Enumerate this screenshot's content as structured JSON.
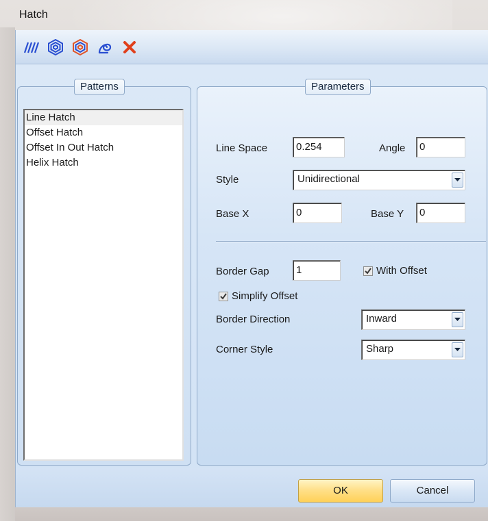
{
  "window": {
    "title": "Hatch"
  },
  "toolbar": {
    "buttons": [
      {
        "icon": "line-hatch-icon"
      },
      {
        "icon": "offset-hatch-icon"
      },
      {
        "icon": "offset-in-out-hatch-icon"
      },
      {
        "icon": "helix-hatch-icon"
      },
      {
        "icon": "close-icon"
      }
    ]
  },
  "patterns": {
    "legend": "Patterns",
    "items": [
      "Line Hatch",
      "Offset Hatch",
      "Offset In Out Hatch",
      "Helix Hatch"
    ],
    "selected": "Line Hatch"
  },
  "parameters": {
    "legend": "Parameters",
    "line_space_label": "Line Space",
    "line_space_value": "0.254",
    "angle_label": "Angle",
    "angle_value": "0",
    "style_label": "Style",
    "style_value": "Unidirectional",
    "base_x_label": "Base X",
    "base_x_value": "0",
    "base_y_label": "Base Y",
    "base_y_value": "0",
    "border_gap_label": "Border Gap",
    "border_gap_value": "1",
    "with_offset_label": "With Offset",
    "with_offset_checked": true,
    "simplify_offset_label": "Simplify Offset",
    "simplify_offset_checked": true,
    "border_direction_label": "Border Direction",
    "border_direction_value": "Inward",
    "corner_style_label": "Corner Style",
    "corner_style_value": "Sharp"
  },
  "footer": {
    "ok_label": "OK",
    "cancel_label": "Cancel"
  },
  "colors": {
    "accent_ok": "#ffd158",
    "panel": "#d3e3f5",
    "close_x": "#e0401c"
  }
}
